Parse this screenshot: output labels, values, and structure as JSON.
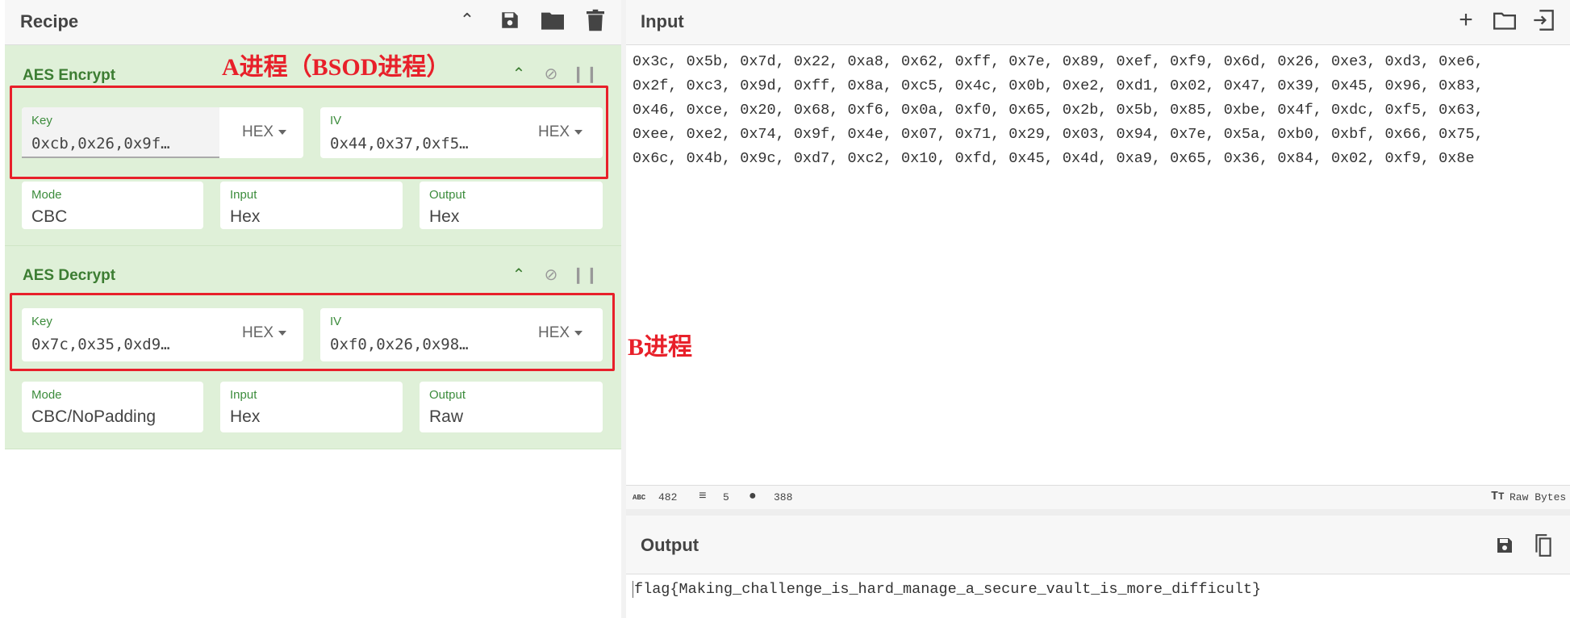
{
  "recipe": {
    "title": "Recipe",
    "icons": [
      "chevron-up-icon",
      "save-icon",
      "folder-icon",
      "trash-icon"
    ]
  },
  "operations": [
    {
      "title": "AES Encrypt",
      "key_label": "Key",
      "key_value": "0xcb,0x26,0x9f…",
      "key_format": "HEX",
      "iv_label": "IV",
      "iv_value": "0x44,0x37,0xf5…",
      "iv_format": "HEX",
      "mode_label": "Mode",
      "mode_value": "CBC",
      "input_label": "Input",
      "input_value": "Hex",
      "output_label": "Output",
      "output_value": "Hex"
    },
    {
      "title": "AES Decrypt",
      "key_label": "Key",
      "key_value": "0x7c,0x35,0xd9…",
      "key_format": "HEX",
      "iv_label": "IV",
      "iv_value": "0xf0,0x26,0x98…",
      "iv_format": "HEX",
      "mode_label": "Mode",
      "mode_value": "CBC/NoPadding",
      "input_label": "Input",
      "input_value": "Hex",
      "output_label": "Output",
      "output_value": "Raw"
    }
  ],
  "annotations": {
    "a": "A进程（BSOD进程）",
    "b": "B进程",
    "color": "#e8202a"
  },
  "input": {
    "title": "Input",
    "text": "0x3c, 0x5b, 0x7d, 0x22, 0xa8, 0x62, 0xff, 0x7e, 0x89, 0xef, 0xf9, 0x6d, 0x26, 0xe3, 0xd3, 0xe6,\n0x2f, 0xc3, 0x9d, 0xff, 0x8a, 0xc5, 0x4c, 0x0b, 0xe2, 0xd1, 0x02, 0x47, 0x39, 0x45, 0x96, 0x83,\n0x46, 0xce, 0x20, 0x68, 0xf6, 0x0a, 0xf0, 0x65, 0x2b, 0x5b, 0x85, 0xbe, 0x4f, 0xdc, 0xf5, 0x63,\n0xee, 0xe2, 0x74, 0x9f, 0x4e, 0x07, 0x71, 0x29, 0x03, 0x94, 0x7e, 0x5a, 0xb0, 0xbf, 0x66, 0x75,\n0x6c, 0x4b, 0x9c, 0xd7, 0xc2, 0x10, 0xfd, 0x45, 0x4d, 0xa9, 0x65, 0x36, 0x84, 0x02, 0xf9, 0x8e"
  },
  "status": {
    "chars": "482",
    "lines": "5",
    "position": "388",
    "encoding": "Raw Bytes"
  },
  "output": {
    "title": "Output",
    "text": "flag{Making_challenge_is_hard_manage_a_secure_vault_is_more_difficult}"
  },
  "colors": {
    "op_bg": "#dff0d8",
    "op_title": "#3c7d32"
  }
}
